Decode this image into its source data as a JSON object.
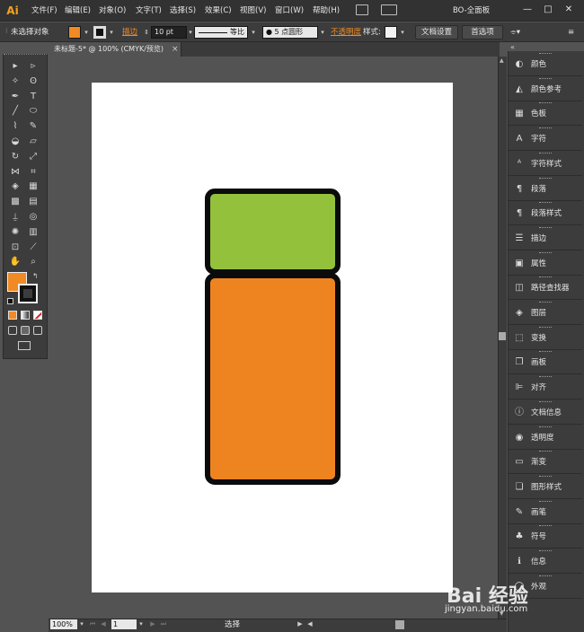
{
  "app": {
    "logo": "Ai",
    "menus": [
      "文件(F)",
      "编辑(E)",
      "对象(O)",
      "文字(T)",
      "选择(S)",
      "效果(C)",
      "视图(V)",
      "窗口(W)",
      "帮助(H)"
    ],
    "workspace": "BO-全面板",
    "window_buttons": [
      "—",
      "□",
      "✕"
    ]
  },
  "control_bar": {
    "selection_status": "未选择对象",
    "stroke_label": "描边",
    "stroke_weight": "10 pt",
    "profile": "等比",
    "brush": "● 5 点圆形",
    "opacity_label": "不透明度",
    "style_label": "样式:",
    "doc_setup": "文档设置",
    "preferences": "首选项"
  },
  "document": {
    "tab_title": "未标题-5* @ 100% (CMYK/预览)",
    "tab_close": "×"
  },
  "colors": {
    "fill": "#f08a24",
    "green_rect": "#94c13c",
    "orange_rect": "#ee841f",
    "stroke": "#0b0b0b"
  },
  "tools": [
    {
      "name": "selection-tool-icon",
      "glyph": "▸"
    },
    {
      "name": "direct-selection-tool-icon",
      "glyph": "▹"
    },
    {
      "name": "magic-wand-icon",
      "glyph": "✧"
    },
    {
      "name": "lasso-icon",
      "glyph": "ʘ"
    },
    {
      "name": "pen-tool-icon",
      "glyph": "✒"
    },
    {
      "name": "type-tool-icon",
      "glyph": "T"
    },
    {
      "name": "line-tool-icon",
      "glyph": "╱"
    },
    {
      "name": "ellipse-tool-icon",
      "glyph": "⬭"
    },
    {
      "name": "paintbrush-icon",
      "glyph": "⌇"
    },
    {
      "name": "pencil-icon",
      "glyph": "✎"
    },
    {
      "name": "blob-brush-icon",
      "glyph": "◒"
    },
    {
      "name": "eraser-icon",
      "glyph": "▱"
    },
    {
      "name": "rotate-tool-icon",
      "glyph": "↻"
    },
    {
      "name": "scale-tool-icon",
      "glyph": "⤢"
    },
    {
      "name": "width-tool-icon",
      "glyph": "⋈"
    },
    {
      "name": "free-transform-icon",
      "glyph": "⌗"
    },
    {
      "name": "shape-builder-icon",
      "glyph": "◈"
    },
    {
      "name": "perspective-grid-icon",
      "glyph": "▦"
    },
    {
      "name": "mesh-tool-icon",
      "glyph": "▩"
    },
    {
      "name": "gradient-tool-icon",
      "glyph": "▤"
    },
    {
      "name": "eyedropper-icon",
      "glyph": "⍊"
    },
    {
      "name": "blend-tool-icon",
      "glyph": "◎"
    },
    {
      "name": "symbol-sprayer-icon",
      "glyph": "✺"
    },
    {
      "name": "column-graph-icon",
      "glyph": "▥"
    },
    {
      "name": "artboard-tool-icon",
      "glyph": "⊡"
    },
    {
      "name": "slice-tool-icon",
      "glyph": "⟋"
    },
    {
      "name": "hand-tool-icon",
      "glyph": "✋"
    },
    {
      "name": "zoom-tool-icon",
      "glyph": "⌕"
    }
  ],
  "panels": [
    {
      "label": "颜色",
      "icon": "color-panel-icon",
      "glyph": "◐"
    },
    {
      "label": "颜色参考",
      "icon": "color-guide-icon",
      "glyph": "◭"
    },
    {
      "label": "色板",
      "icon": "swatches-icon",
      "glyph": "▦"
    },
    {
      "label": "字符",
      "icon": "character-icon",
      "glyph": "A"
    },
    {
      "label": "字符样式",
      "icon": "character-styles-icon",
      "glyph": "ᴬ"
    },
    {
      "label": "段落",
      "icon": "paragraph-icon",
      "glyph": "¶"
    },
    {
      "label": "段落样式",
      "icon": "paragraph-styles-icon",
      "glyph": "¶"
    },
    {
      "label": "描边",
      "icon": "stroke-icon",
      "glyph": "☰"
    },
    {
      "label": "属性",
      "icon": "attributes-icon",
      "glyph": "▣"
    },
    {
      "label": "路径查找器",
      "icon": "pathfinder-icon",
      "glyph": "◫"
    },
    {
      "label": "图层",
      "icon": "layers-icon",
      "glyph": "◈"
    },
    {
      "label": "变换",
      "icon": "transform-icon",
      "glyph": "⬚"
    },
    {
      "label": "画板",
      "icon": "artboards-icon",
      "glyph": "❐"
    },
    {
      "label": "对齐",
      "icon": "align-icon",
      "glyph": "⊫"
    },
    {
      "label": "文档信息",
      "icon": "document-info-icon",
      "glyph": "ⓘ"
    },
    {
      "label": "透明度",
      "icon": "transparency-icon",
      "glyph": "◉"
    },
    {
      "label": "渐变",
      "icon": "gradient-icon",
      "glyph": "▭"
    },
    {
      "label": "图形样式",
      "icon": "graphic-styles-icon",
      "glyph": "❏"
    },
    {
      "label": "画笔",
      "icon": "brushes-icon",
      "glyph": "✎"
    },
    {
      "label": "符号",
      "icon": "symbols-icon",
      "glyph": "♣"
    },
    {
      "label": "信息",
      "icon": "info-icon",
      "glyph": "ℹ"
    },
    {
      "label": "外观",
      "icon": "appearance-icon",
      "glyph": "◯"
    }
  ],
  "status": {
    "zoom": "100%",
    "page": "1",
    "tool": "选择"
  },
  "watermark": {
    "main": "Bai 经验",
    "sub": "jingyan.baidu.com"
  }
}
